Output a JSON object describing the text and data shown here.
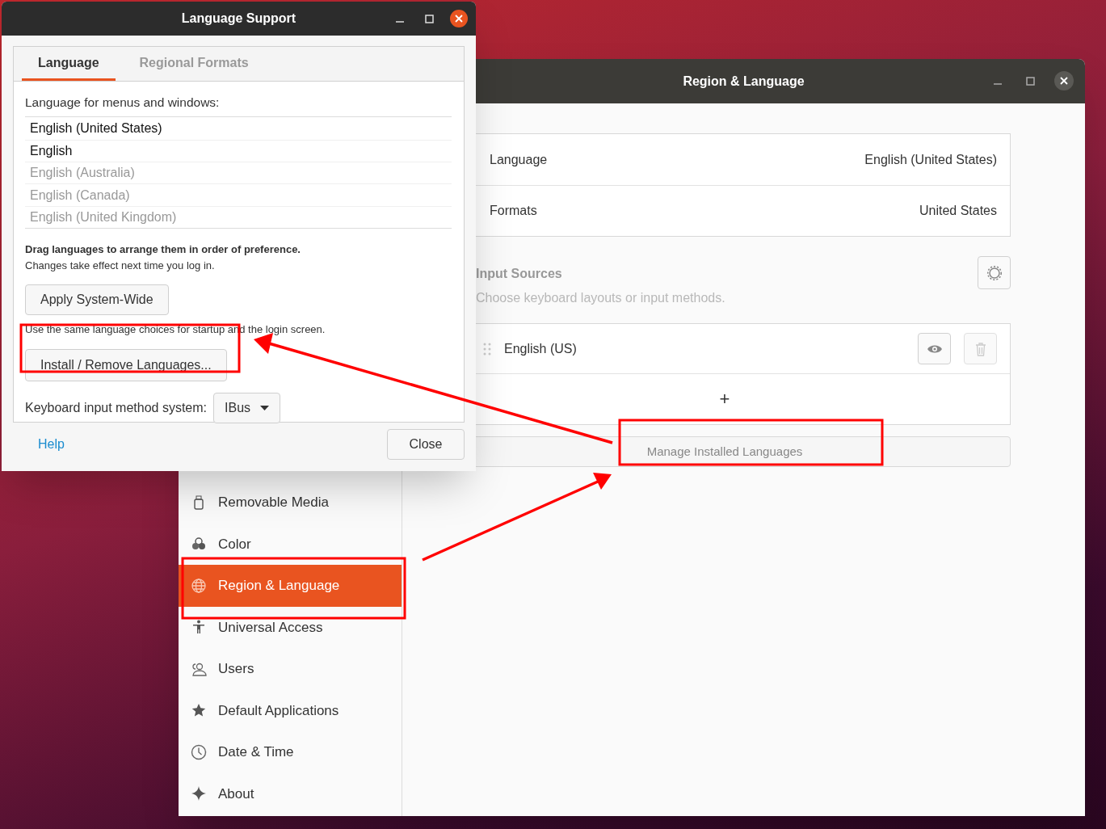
{
  "language_support": {
    "title": "Language Support",
    "tabs": [
      {
        "label": "Language",
        "selected": true
      },
      {
        "label": "Regional Formats",
        "selected": false
      }
    ],
    "languages_label": "Language for menus and windows:",
    "languages": [
      {
        "name": "English (United States)",
        "greyed": false
      },
      {
        "name": "English",
        "greyed": false
      },
      {
        "name": "English (Australia)",
        "greyed": true
      },
      {
        "name": "English (Canada)",
        "greyed": true
      },
      {
        "name": "English (United Kingdom)",
        "greyed": true
      }
    ],
    "drag_hint": "Drag languages to arrange them in order of preference.",
    "login_note": "Changes take effect next time you log in.",
    "apply_button": "Apply System-Wide",
    "apply_note": "Use the same language choices for startup and the login screen.",
    "install_button": "Install / Remove Languages...",
    "input_method_label": "Keyboard input method system:",
    "input_method_value": "IBus",
    "help_link": "Help",
    "close_button": "Close"
  },
  "region_window": {
    "title": "Region & Language",
    "settings": [
      {
        "label": "Language",
        "value": "English (United States)"
      },
      {
        "label": "Formats",
        "value": "United States"
      }
    ],
    "input_sources": {
      "heading": "Input Sources",
      "subtitle": "Choose keyboard layouts or input methods.",
      "sources": [
        "English (US)"
      ],
      "add_button": "+"
    },
    "manage_button": "Manage Installed Languages"
  },
  "sidebar": {
    "items": [
      {
        "label": "Removable Media",
        "selected": false
      },
      {
        "label": "Color",
        "selected": false
      },
      {
        "label": "Region & Language",
        "selected": true
      },
      {
        "label": "Universal Access",
        "selected": false
      },
      {
        "label": "Users",
        "selected": false
      },
      {
        "label": "Default Applications",
        "selected": false
      },
      {
        "label": "Date & Time",
        "selected": false
      },
      {
        "label": "About",
        "selected": false
      }
    ]
  }
}
